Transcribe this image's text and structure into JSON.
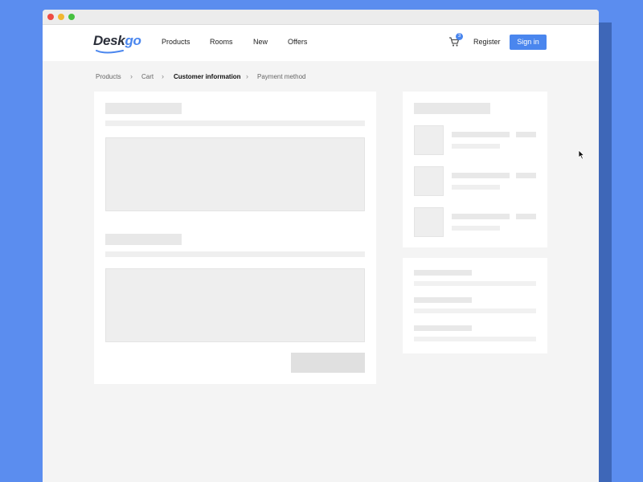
{
  "brand": {
    "part1": "Desk",
    "part2": "go",
    "accent": "#4a86ee"
  },
  "nav": {
    "links": [
      "Products",
      "Rooms",
      "New",
      "Offers"
    ],
    "cart_count": "3",
    "register_label": "Register",
    "signin_label": "Sign in"
  },
  "breadcrumb": {
    "items": [
      "Products",
      "Cart",
      "Customer information",
      "Payment method"
    ],
    "current_index": 2
  },
  "icons": {
    "cart": "cart-icon",
    "chevron": "chevron-right-icon",
    "cursor": "mouse-pointer-icon"
  }
}
